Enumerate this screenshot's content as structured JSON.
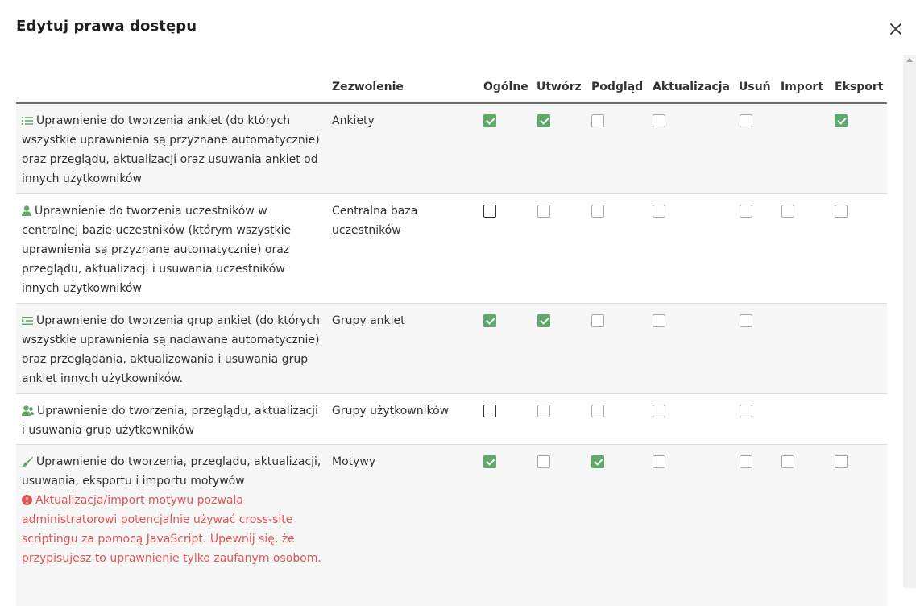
{
  "modal": {
    "title": "Edytuj prawa dostępu",
    "close_icon": "close-icon"
  },
  "table": {
    "headers": {
      "permission": "Zezwolenie",
      "general": "Ogólne",
      "create": "Utwórz",
      "preview": "Podgląd",
      "update": "Aktualizacja",
      "delete": "Usuń",
      "import": "Import",
      "export": "Eksport"
    },
    "rows": [
      {
        "icon": "list-icon",
        "description": "Uprawnienie do tworzenia ankiet (do których wszystkie uprawnienia są przyznane automatycznie) oraz przeglądu, aktualizacji oraz usuwania ankiet od innych użytkowników",
        "permission": "Ankiety",
        "checks": {
          "general": true,
          "create": true,
          "preview": false,
          "update": false,
          "delete": false,
          "import": null,
          "export": true
        }
      },
      {
        "icon": "user-icon",
        "description": "Uprawnienie do tworzenia uczestników w centralnej bazie uczestników (którym wszystkie uprawnienia są przyznane automatycznie) oraz przeglądu, aktualizacji i usuwania uczestników innych użytkowników",
        "permission": "Centralna baza uczestników",
        "checks": {
          "general": false,
          "create": false,
          "preview": false,
          "update": false,
          "delete": false,
          "import": false,
          "export": false
        }
      },
      {
        "icon": "indent-list-icon",
        "description": "Uprawnienie do tworzenia grup ankiet (do których wszystkie uprawnienia są nadawane automatycznie) oraz przeglądania, aktualizowania i usuwania grup ankiet innych użytkowników.",
        "permission": "Grupy ankiet",
        "checks": {
          "general": true,
          "create": true,
          "preview": false,
          "update": false,
          "delete": false,
          "import": null,
          "export": null
        }
      },
      {
        "icon": "user-group-icon",
        "description": "Uprawnienie do tworzenia, przeglądu, aktualizacji i usuwania grup użytkowników",
        "permission": "Grupy użytkowników",
        "checks": {
          "general": false,
          "create": false,
          "preview": false,
          "update": false,
          "delete": false,
          "import": null,
          "export": null
        }
      },
      {
        "icon": "paint-brush-icon",
        "description": "Uprawnienie do tworzenia, przeglądu, aktualizacji, usuwania, eksportu i importu motywów",
        "warning_icon": "exclamation-circle-icon",
        "warning": "Aktualizacja/import motywu pozwala administratorowi potencjalnie używać cross-site scriptingu za pomocą JavaScript. Upewnij się, że przypisujesz to uprawnienie tylko zaufanym osobom.",
        "permission": "Motywy",
        "checks": {
          "general": true,
          "create": false,
          "preview": true,
          "update": false,
          "delete": false,
          "import": false,
          "export": false
        }
      }
    ]
  },
  "colors": {
    "accent_green": "#5fa96a",
    "warning_red": "#e25454",
    "header_border": "#6b6b6b"
  }
}
